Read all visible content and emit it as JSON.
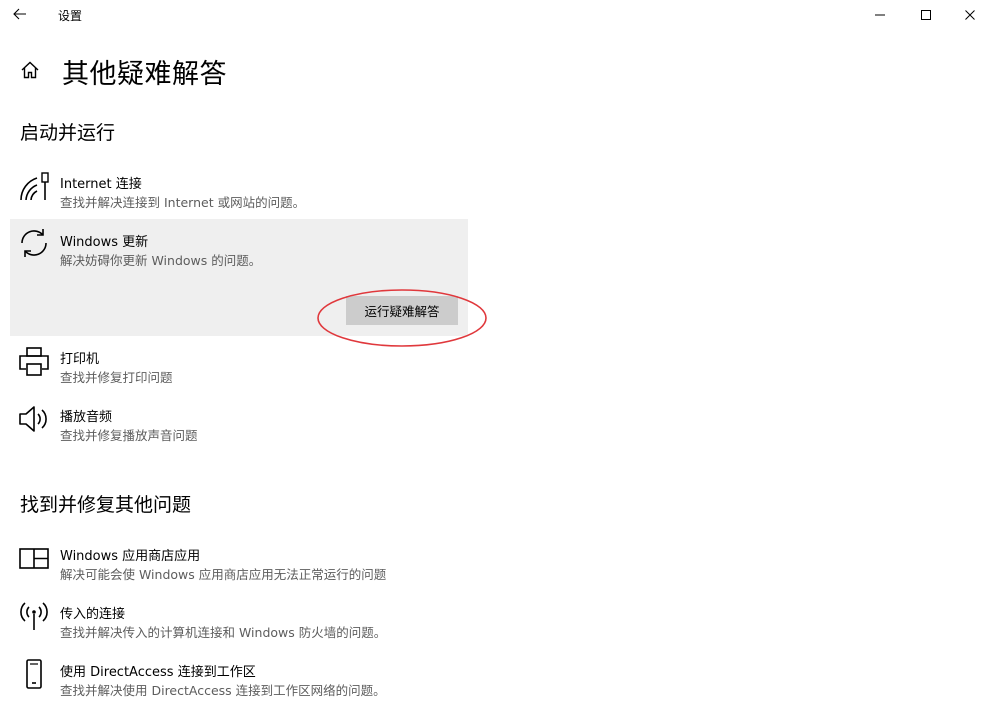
{
  "window": {
    "title": "设置"
  },
  "page": {
    "title": "其他疑难解答"
  },
  "sections": [
    {
      "title": "启动并运行"
    },
    {
      "title": "找到并修复其他问题"
    }
  ],
  "items": [
    {
      "title": "Internet 连接",
      "desc": "查找并解决连接到 Internet 或网站的问题。",
      "icon": "wifi-icon"
    },
    {
      "title": "Windows 更新",
      "desc": "解决妨碍你更新 Windows 的问题。",
      "icon": "sync-icon",
      "selected": true
    },
    {
      "title": "打印机",
      "desc": "查找并修复打印问题",
      "icon": "printer-icon"
    },
    {
      "title": "播放音频",
      "desc": "查找并修复播放声音问题",
      "icon": "speaker-icon"
    },
    {
      "title": "Windows 应用商店应用",
      "desc": "解决可能会使 Windows 应用商店应用无法正常运行的问题",
      "icon": "store-app-icon"
    },
    {
      "title": "传入的连接",
      "desc": "查找并解决传入的计算机连接和 Windows 防火墙的问题。",
      "icon": "antenna-icon"
    },
    {
      "title": "使用 DirectAccess 连接到工作区",
      "desc": "查找并解决使用 DirectAccess 连接到工作区网络的问题。",
      "icon": "phone-icon"
    }
  ],
  "run_button": {
    "label": "运行疑难解答"
  },
  "colors": {
    "selected_bg": "#efefef",
    "button_bg": "#cccccc",
    "annotation": "#e0383c",
    "desc_text": "#5d5d5d"
  }
}
